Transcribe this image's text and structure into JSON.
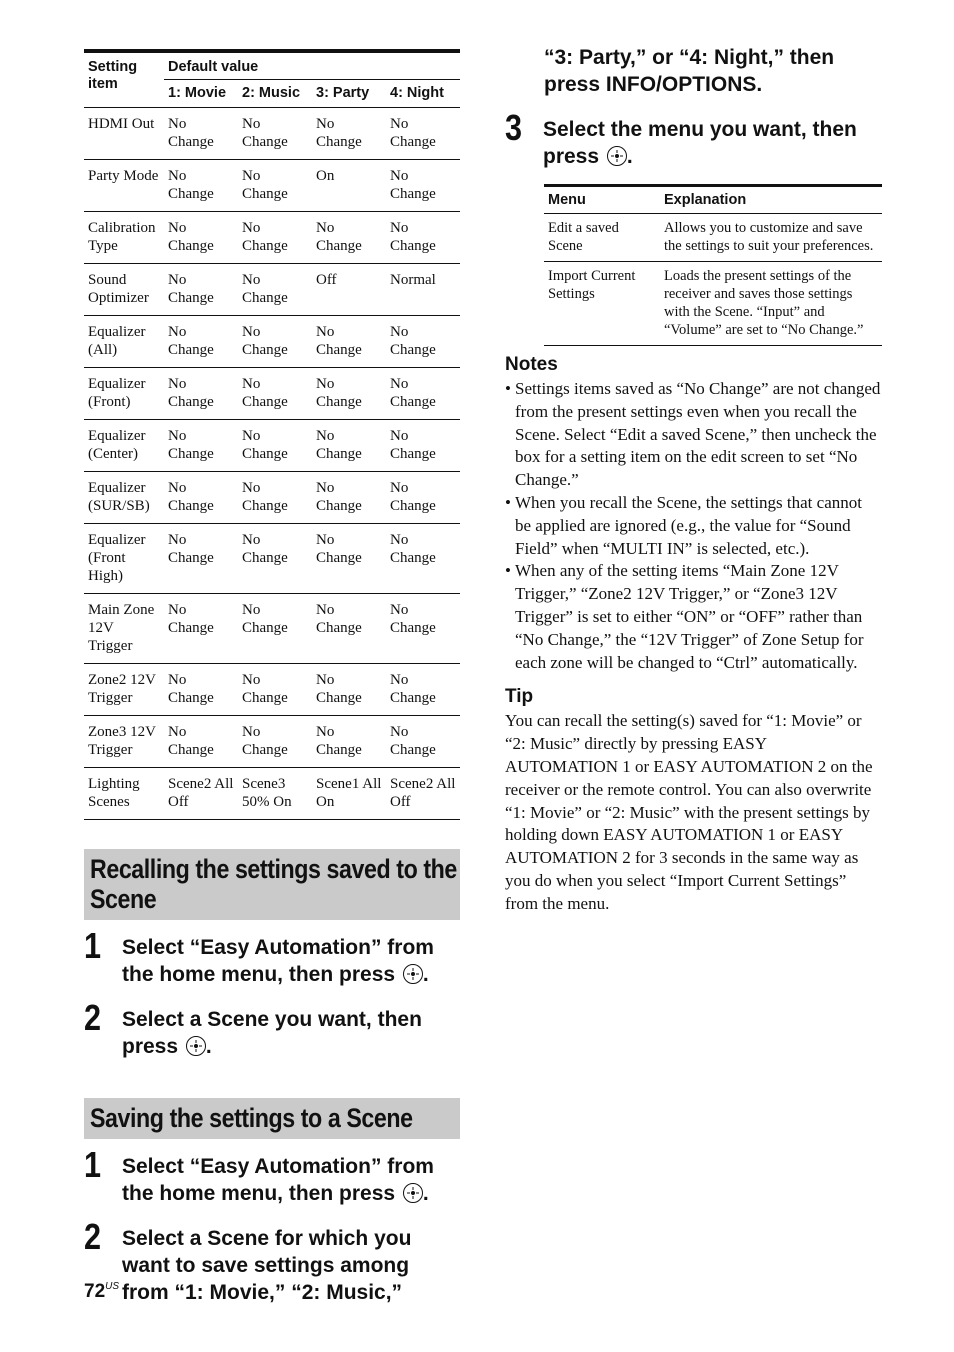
{
  "settings_table": {
    "header_item": "Setting item",
    "header_default": "Default value",
    "columns": [
      "1: Movie",
      "2: Music",
      "3: Party",
      "4: Night"
    ],
    "rows": [
      {
        "item": "HDMI Out",
        "values": [
          "No Change",
          "No Change",
          "No Change",
          "No Change"
        ]
      },
      {
        "item": "Party Mode",
        "values": [
          "No Change",
          "No Change",
          "On",
          "No Change"
        ]
      },
      {
        "item": "Calibration Type",
        "values": [
          "No Change",
          "No Change",
          "No Change",
          "No Change"
        ]
      },
      {
        "item": "Sound Optimizer",
        "values": [
          "No Change",
          "No Change",
          "Off",
          "Normal"
        ]
      },
      {
        "item": "Equalizer (All)",
        "values": [
          "No Change",
          "No Change",
          "No Change",
          "No Change"
        ]
      },
      {
        "item": "Equalizer (Front)",
        "values": [
          "No Change",
          "No Change",
          "No Change",
          "No Change"
        ]
      },
      {
        "item": "Equalizer (Center)",
        "values": [
          "No Change",
          "No Change",
          "No Change",
          "No Change"
        ]
      },
      {
        "item": "Equalizer (SUR/SB)",
        "values": [
          "No Change",
          "No Change",
          "No Change",
          "No Change"
        ]
      },
      {
        "item": "Equalizer (Front High)",
        "values": [
          "No Change",
          "No Change",
          "No Change",
          "No Change"
        ]
      },
      {
        "item": "Main Zone 12V Trigger",
        "values": [
          "No Change",
          "No Change",
          "No Change",
          "No Change"
        ]
      },
      {
        "item": "Zone2 12V Trigger",
        "values": [
          "No Change",
          "No Change",
          "No Change",
          "No Change"
        ]
      },
      {
        "item": "Zone3 12V Trigger",
        "values": [
          "No Change",
          "No Change",
          "No Change",
          "No Change"
        ]
      },
      {
        "item": "Lighting Scenes",
        "values": [
          "Scene2 All Off",
          "Scene3 50% On",
          "Scene1 All On",
          "Scene2 All Off"
        ]
      }
    ]
  },
  "recall_section": {
    "title": "Recalling the settings saved to the Scene",
    "steps": [
      {
        "num": "1",
        "text": "Select “Easy Automation” from the home menu, then press",
        "icon": "enter-button-icon",
        "after": "."
      },
      {
        "num": "2",
        "text": "Select a Scene you want, then press",
        "icon": "enter-button-icon",
        "after": "."
      }
    ]
  },
  "save_section": {
    "title": "Saving the settings to a Scene",
    "steps": [
      {
        "num": "1",
        "text": "Select “Easy Automation” from the home menu, then press",
        "icon": "enter-button-icon",
        "after": "."
      },
      {
        "num": "2",
        "text": "Select a Scene for which you want to save settings among from “1: Movie,” “2: Music,”"
      }
    ],
    "step2_continued": "“3: Party,” or “4: Night,” then press INFO/OPTIONS.",
    "step3": {
      "num": "3",
      "text": "Select the menu you want, then press",
      "icon": "enter-button-icon",
      "after": "."
    }
  },
  "menu_table": {
    "headers": [
      "Menu",
      "Explanation"
    ],
    "rows": [
      {
        "menu": "Edit a saved Scene",
        "explanation": "Allows you to customize and save the settings to suit your preferences."
      },
      {
        "menu": "Import Current Settings",
        "explanation": "Loads the present settings of the receiver and saves those settings with the Scene. “Input” and “Volume” are set to “No Change.”"
      }
    ]
  },
  "notes": {
    "title": "Notes",
    "items": [
      "Settings items saved as “No Change” are not changed from the present settings even when you recall the Scene. Select “Edit a saved Scene,” then uncheck the box for a setting item on the edit screen to set “No Change.”",
      "When you recall the Scene, the settings that cannot be applied are ignored (e.g., the value for “Sound Field” when “MULTI IN” is selected, etc.).",
      "When any of the setting items “Main Zone 12V Trigger,” “Zone2 12V Trigger,” or “Zone3 12V Trigger” is set to either “ON” or “OFF” rather than “No Change,” the “12V Trigger” of Zone Setup for each zone will be changed to “Ctrl” automatically."
    ]
  },
  "tip": {
    "title": "Tip",
    "text": "You can recall the setting(s) saved for “1: Movie” or “2: Music” directly by pressing EASY AUTOMATION 1 or EASY AUTOMATION 2 on the receiver or the remote control. You can also overwrite “1: Movie” or “2: Music” with the present settings by holding down EASY AUTOMATION 1 or EASY AUTOMATION 2 for 3 seconds in the same way as you do when you select “Import Current Settings” from the menu."
  },
  "footer": {
    "page_number": "72",
    "region": "US"
  }
}
